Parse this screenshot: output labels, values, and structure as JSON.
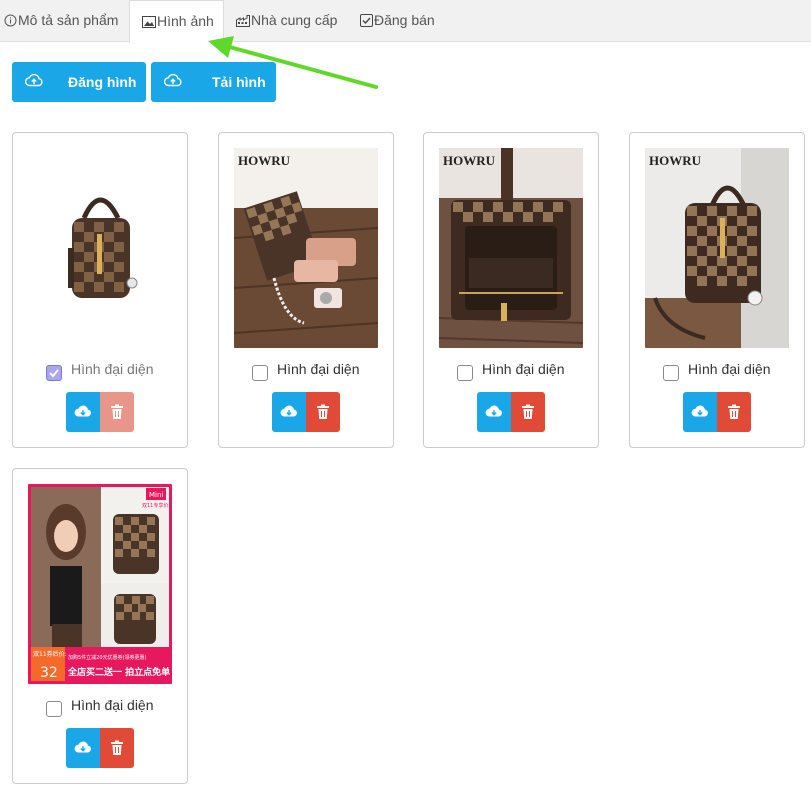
{
  "tabs": [
    {
      "label": "Mô tả sản phẩm",
      "icon": "info-icon",
      "active": false
    },
    {
      "label": "Hình ảnh",
      "icon": "image-icon",
      "active": true
    },
    {
      "label": "Nhà cung cấp",
      "icon": "factory-icon",
      "active": false
    },
    {
      "label": "Đăng bán",
      "icon": "checkbox-icon",
      "active": false
    }
  ],
  "toolbar": {
    "post_image_label": "Đăng hình",
    "download_image_label": "Tải hình",
    "icon": "cloud-upload-icon"
  },
  "images": [
    {
      "caption": "Hình đại diện",
      "is_main": true,
      "watermark": "",
      "disabled_delete": true
    },
    {
      "caption": "Hình đại diện",
      "is_main": false,
      "watermark": "HOWRU",
      "disabled_delete": false
    },
    {
      "caption": "Hình đại diện",
      "is_main": false,
      "watermark": "HOWRU",
      "disabled_delete": false
    },
    {
      "caption": "Hình đại diện",
      "is_main": false,
      "watermark": "HOWRU",
      "disabled_delete": false
    },
    {
      "caption": "Hình đại diện",
      "is_main": false,
      "watermark": "",
      "disabled_delete": false,
      "promo": {
        "badge": "Mini",
        "sub_badge": "双11专享价",
        "price_label": "双11券后价:",
        "price": "32",
        "coupon_line": "加购5件立减20元优惠券(领券更惠)",
        "banner": "全店买二送一 拍立点免单"
      }
    }
  ],
  "colors": {
    "primary": "#1aa7e8",
    "danger": "#e04a36",
    "danger_disabled": "#e8968a",
    "tab_bar": "#f1f1f1",
    "arrow": "#5fd82a"
  }
}
